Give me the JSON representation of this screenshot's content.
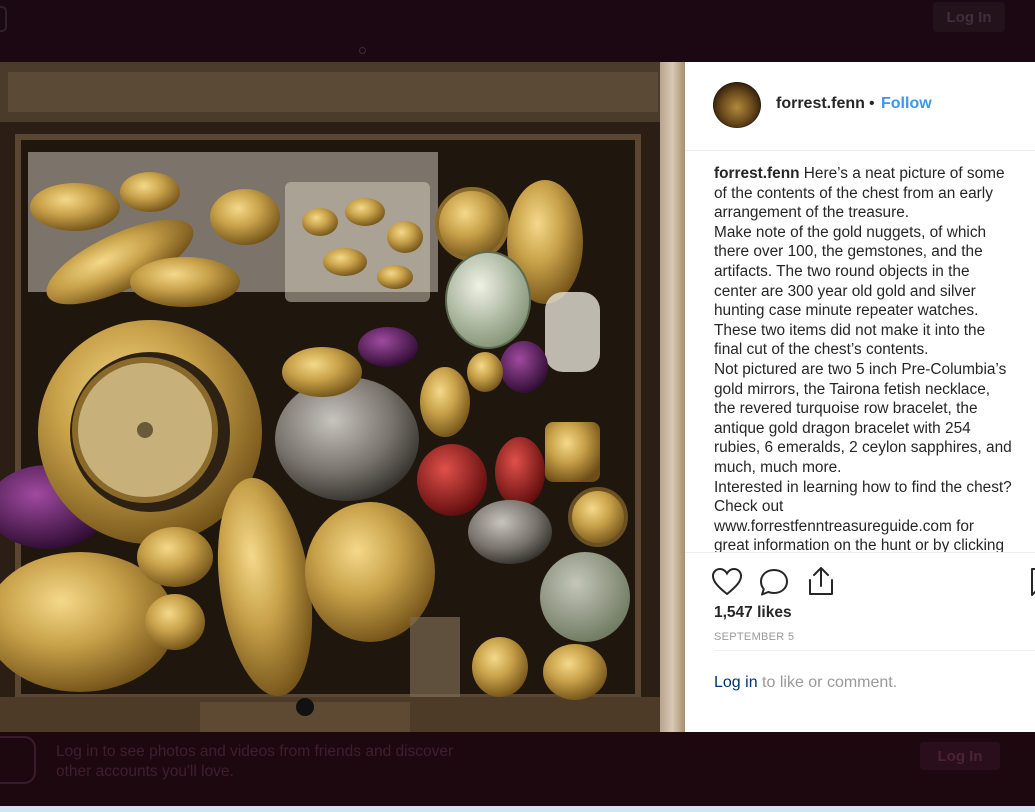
{
  "top_nav": {
    "login_label": "Log In"
  },
  "post": {
    "username": "forrest.fenn",
    "separator": "•",
    "follow_label": "Follow",
    "caption_lines": [
      "Here’s a neat picture of some",
      "of the contents of the chest from an early",
      "arrangement of the treasure.",
      "Make note of the gold nuggets, of which",
      "there over 100, the gemstones, and the",
      "artifacts. The two round objects in the",
      "center are 300 year old gold and silver",
      "hunting case minute repeater watches.",
      "These two items did not make it into the",
      "final cut of the chest’s contents.",
      "Not pictured are two 5 inch Pre-Columbia’s",
      "gold mirrors, the Tairona fetish necklace,",
      "the revered turquoise row bracelet, the",
      "antique gold dragon bracelet with 254",
      "rubies, 6 emeralds, 2 ceylon sapphires, and",
      "much, much more.",
      "Interested in learning how to find the chest?",
      "Check out",
      "www.forrestfenntreasureguide.com for",
      "great information on the hunt or by clicking"
    ],
    "likes": "1,547 likes",
    "date": "SEPTEMBER 5",
    "login_link": "Log in",
    "login_suffix": " to like or comment."
  },
  "icons": {
    "like": "heart-icon",
    "comment": "comment-icon",
    "share": "share-icon",
    "save": "bookmark-icon"
  },
  "bottom_banner": {
    "line1": "Log in to see photos and videos from friends and discover",
    "line2": "other accounts you'll love.",
    "login_label": "Log In"
  },
  "colors": {
    "link_blue": "#3897f0",
    "text_dark": "#262626",
    "muted": "#999999",
    "backdrop": "#1c0812"
  }
}
